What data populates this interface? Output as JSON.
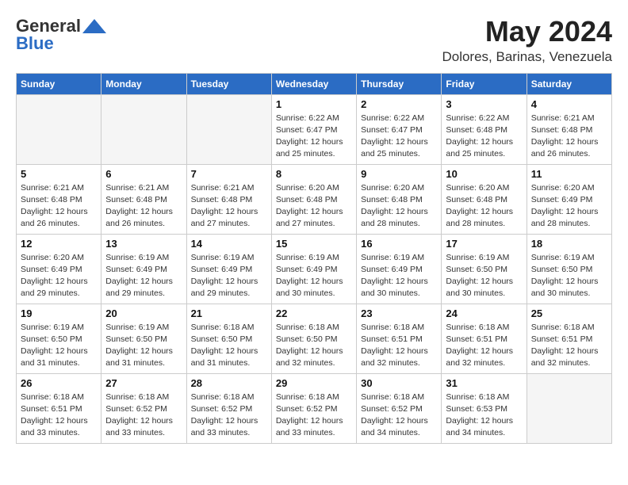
{
  "header": {
    "logo_general": "General",
    "logo_blue": "Blue",
    "title": "May 2024",
    "location": "Dolores, Barinas, Venezuela"
  },
  "days_of_week": [
    "Sunday",
    "Monday",
    "Tuesday",
    "Wednesday",
    "Thursday",
    "Friday",
    "Saturday"
  ],
  "weeks": [
    [
      {
        "num": "",
        "info": ""
      },
      {
        "num": "",
        "info": ""
      },
      {
        "num": "",
        "info": ""
      },
      {
        "num": "1",
        "info": "Sunrise: 6:22 AM\nSunset: 6:47 PM\nDaylight: 12 hours\nand 25 minutes."
      },
      {
        "num": "2",
        "info": "Sunrise: 6:22 AM\nSunset: 6:47 PM\nDaylight: 12 hours\nand 25 minutes."
      },
      {
        "num": "3",
        "info": "Sunrise: 6:22 AM\nSunset: 6:48 PM\nDaylight: 12 hours\nand 25 minutes."
      },
      {
        "num": "4",
        "info": "Sunrise: 6:21 AM\nSunset: 6:48 PM\nDaylight: 12 hours\nand 26 minutes."
      }
    ],
    [
      {
        "num": "5",
        "info": "Sunrise: 6:21 AM\nSunset: 6:48 PM\nDaylight: 12 hours\nand 26 minutes."
      },
      {
        "num": "6",
        "info": "Sunrise: 6:21 AM\nSunset: 6:48 PM\nDaylight: 12 hours\nand 26 minutes."
      },
      {
        "num": "7",
        "info": "Sunrise: 6:21 AM\nSunset: 6:48 PM\nDaylight: 12 hours\nand 27 minutes."
      },
      {
        "num": "8",
        "info": "Sunrise: 6:20 AM\nSunset: 6:48 PM\nDaylight: 12 hours\nand 27 minutes."
      },
      {
        "num": "9",
        "info": "Sunrise: 6:20 AM\nSunset: 6:48 PM\nDaylight: 12 hours\nand 28 minutes."
      },
      {
        "num": "10",
        "info": "Sunrise: 6:20 AM\nSunset: 6:48 PM\nDaylight: 12 hours\nand 28 minutes."
      },
      {
        "num": "11",
        "info": "Sunrise: 6:20 AM\nSunset: 6:49 PM\nDaylight: 12 hours\nand 28 minutes."
      }
    ],
    [
      {
        "num": "12",
        "info": "Sunrise: 6:20 AM\nSunset: 6:49 PM\nDaylight: 12 hours\nand 29 minutes."
      },
      {
        "num": "13",
        "info": "Sunrise: 6:19 AM\nSunset: 6:49 PM\nDaylight: 12 hours\nand 29 minutes."
      },
      {
        "num": "14",
        "info": "Sunrise: 6:19 AM\nSunset: 6:49 PM\nDaylight: 12 hours\nand 29 minutes."
      },
      {
        "num": "15",
        "info": "Sunrise: 6:19 AM\nSunset: 6:49 PM\nDaylight: 12 hours\nand 30 minutes."
      },
      {
        "num": "16",
        "info": "Sunrise: 6:19 AM\nSunset: 6:49 PM\nDaylight: 12 hours\nand 30 minutes."
      },
      {
        "num": "17",
        "info": "Sunrise: 6:19 AM\nSunset: 6:50 PM\nDaylight: 12 hours\nand 30 minutes."
      },
      {
        "num": "18",
        "info": "Sunrise: 6:19 AM\nSunset: 6:50 PM\nDaylight: 12 hours\nand 30 minutes."
      }
    ],
    [
      {
        "num": "19",
        "info": "Sunrise: 6:19 AM\nSunset: 6:50 PM\nDaylight: 12 hours\nand 31 minutes."
      },
      {
        "num": "20",
        "info": "Sunrise: 6:19 AM\nSunset: 6:50 PM\nDaylight: 12 hours\nand 31 minutes."
      },
      {
        "num": "21",
        "info": "Sunrise: 6:18 AM\nSunset: 6:50 PM\nDaylight: 12 hours\nand 31 minutes."
      },
      {
        "num": "22",
        "info": "Sunrise: 6:18 AM\nSunset: 6:50 PM\nDaylight: 12 hours\nand 32 minutes."
      },
      {
        "num": "23",
        "info": "Sunrise: 6:18 AM\nSunset: 6:51 PM\nDaylight: 12 hours\nand 32 minutes."
      },
      {
        "num": "24",
        "info": "Sunrise: 6:18 AM\nSunset: 6:51 PM\nDaylight: 12 hours\nand 32 minutes."
      },
      {
        "num": "25",
        "info": "Sunrise: 6:18 AM\nSunset: 6:51 PM\nDaylight: 12 hours\nand 32 minutes."
      }
    ],
    [
      {
        "num": "26",
        "info": "Sunrise: 6:18 AM\nSunset: 6:51 PM\nDaylight: 12 hours\nand 33 minutes."
      },
      {
        "num": "27",
        "info": "Sunrise: 6:18 AM\nSunset: 6:52 PM\nDaylight: 12 hours\nand 33 minutes."
      },
      {
        "num": "28",
        "info": "Sunrise: 6:18 AM\nSunset: 6:52 PM\nDaylight: 12 hours\nand 33 minutes."
      },
      {
        "num": "29",
        "info": "Sunrise: 6:18 AM\nSunset: 6:52 PM\nDaylight: 12 hours\nand 33 minutes."
      },
      {
        "num": "30",
        "info": "Sunrise: 6:18 AM\nSunset: 6:52 PM\nDaylight: 12 hours\nand 34 minutes."
      },
      {
        "num": "31",
        "info": "Sunrise: 6:18 AM\nSunset: 6:53 PM\nDaylight: 12 hours\nand 34 minutes."
      },
      {
        "num": "",
        "info": ""
      }
    ]
  ]
}
